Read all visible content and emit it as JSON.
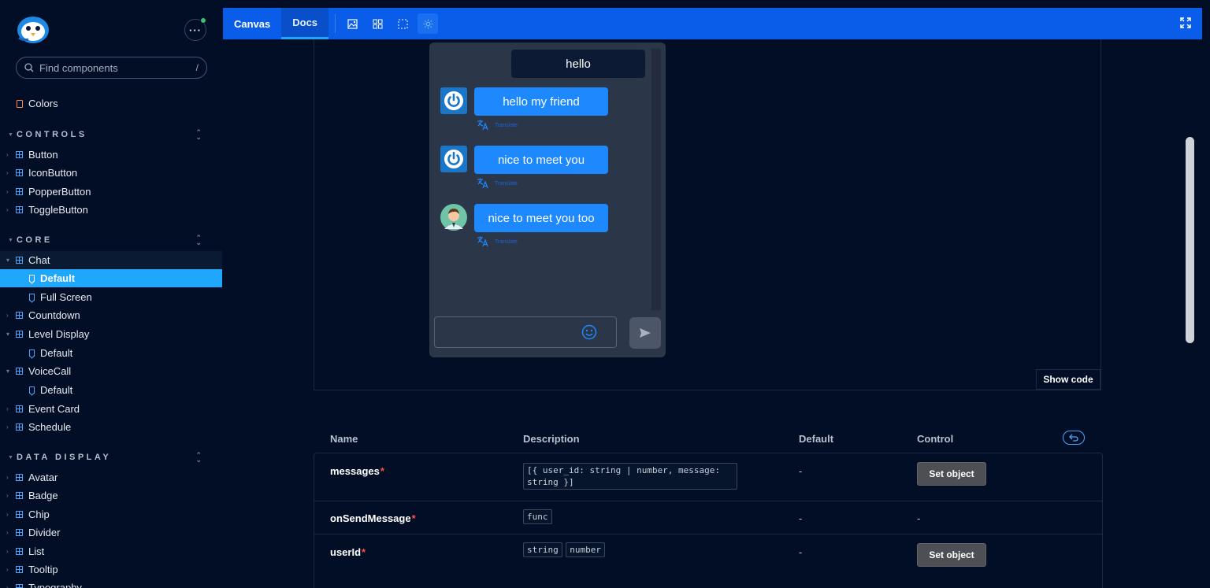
{
  "search": {
    "placeholder": "Find components",
    "shortcut": "/"
  },
  "sidebar": {
    "colors_label": "Colors",
    "sections": [
      {
        "title": "CONTROLS"
      },
      {
        "title": "CORE"
      },
      {
        "title": "DATA DISPLAY"
      }
    ],
    "controls": [
      "Button",
      "IconButton",
      "PopperButton",
      "ToggleButton"
    ],
    "core": {
      "chat": "Chat",
      "chat_default": "Default",
      "chat_fullscreen": "Full Screen",
      "countdown": "Countdown",
      "level_display": "Level Display",
      "level_default": "Default",
      "voicecall": "VoiceCall",
      "voicecall_default": "Default",
      "event_card": "Event Card",
      "schedule": "Schedule"
    },
    "data_display": [
      "Avatar",
      "Badge",
      "Chip",
      "Divider",
      "List",
      "Tooltip",
      "Typography"
    ]
  },
  "toolbar": {
    "tabs": [
      "Canvas",
      "Docs"
    ],
    "active_tab": "Docs"
  },
  "chat": {
    "my_message": "hello",
    "messages": [
      {
        "text": "hello my friend",
        "translate": "Translate"
      },
      {
        "text": "nice to meet you",
        "translate": "Translate"
      },
      {
        "text": "nice to meet you too",
        "translate": "Translate"
      }
    ]
  },
  "preview": {
    "show_code": "Show code"
  },
  "args_table": {
    "headers": {
      "name": "Name",
      "description": "Description",
      "default": "Default",
      "control": "Control"
    },
    "rows": [
      {
        "name": "messages",
        "required": "*",
        "type": "[{ user_id: string | number, message: string }]",
        "default": "-",
        "control": "Set object"
      },
      {
        "name": "onSendMessage",
        "required": "*",
        "type": "func",
        "default": "-",
        "control": "-"
      },
      {
        "name": "userId",
        "required": "*",
        "types": [
          "string",
          "number"
        ],
        "default": "-",
        "control": "Set object"
      }
    ]
  },
  "colors": {
    "accent": "#1ea7fd",
    "toolbar": "#0a5de8",
    "bubble": "#1e88ff",
    "required": "#ff4d4d"
  }
}
